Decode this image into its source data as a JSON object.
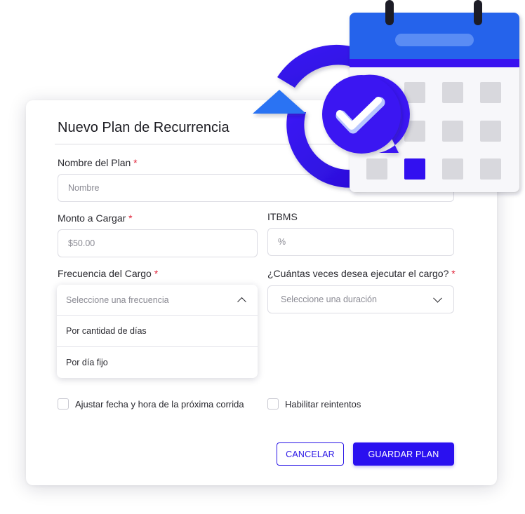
{
  "form": {
    "title": "Nuevo Plan de Recurrencia",
    "plan_name": {
      "label": "Nombre del Plan",
      "required": "*",
      "placeholder": "Nombre"
    },
    "amount": {
      "label": "Monto a Cargar",
      "required": "*",
      "placeholder": "$50.00"
    },
    "itbms": {
      "label": "ITBMS",
      "placeholder": "%"
    },
    "frequency": {
      "label": "Frecuencia del Cargo",
      "required": "*",
      "placeholder": "Seleccione una frecuencia",
      "options": [
        "Por cantidad de días",
        "Por día fijo"
      ]
    },
    "duration": {
      "label": "¿Cuántas veces desea ejecutar el cargo?",
      "required": "*",
      "placeholder": "Seleccione una duración"
    },
    "checkboxes": {
      "adjust": "Ajustar fecha y hora de la próxima corrida",
      "retries": "Habilitar reintentos"
    },
    "buttons": {
      "cancel": "CANCELAR",
      "save": "GUARDAR PLAN"
    }
  },
  "colors": {
    "primary": "#2a10f0",
    "calendar_blue": "#2563eb",
    "required": "#e0243a"
  },
  "illustration": {
    "icons": [
      "calendar-icon",
      "refresh-arrow-icon",
      "checkmark-badge-icon"
    ]
  }
}
